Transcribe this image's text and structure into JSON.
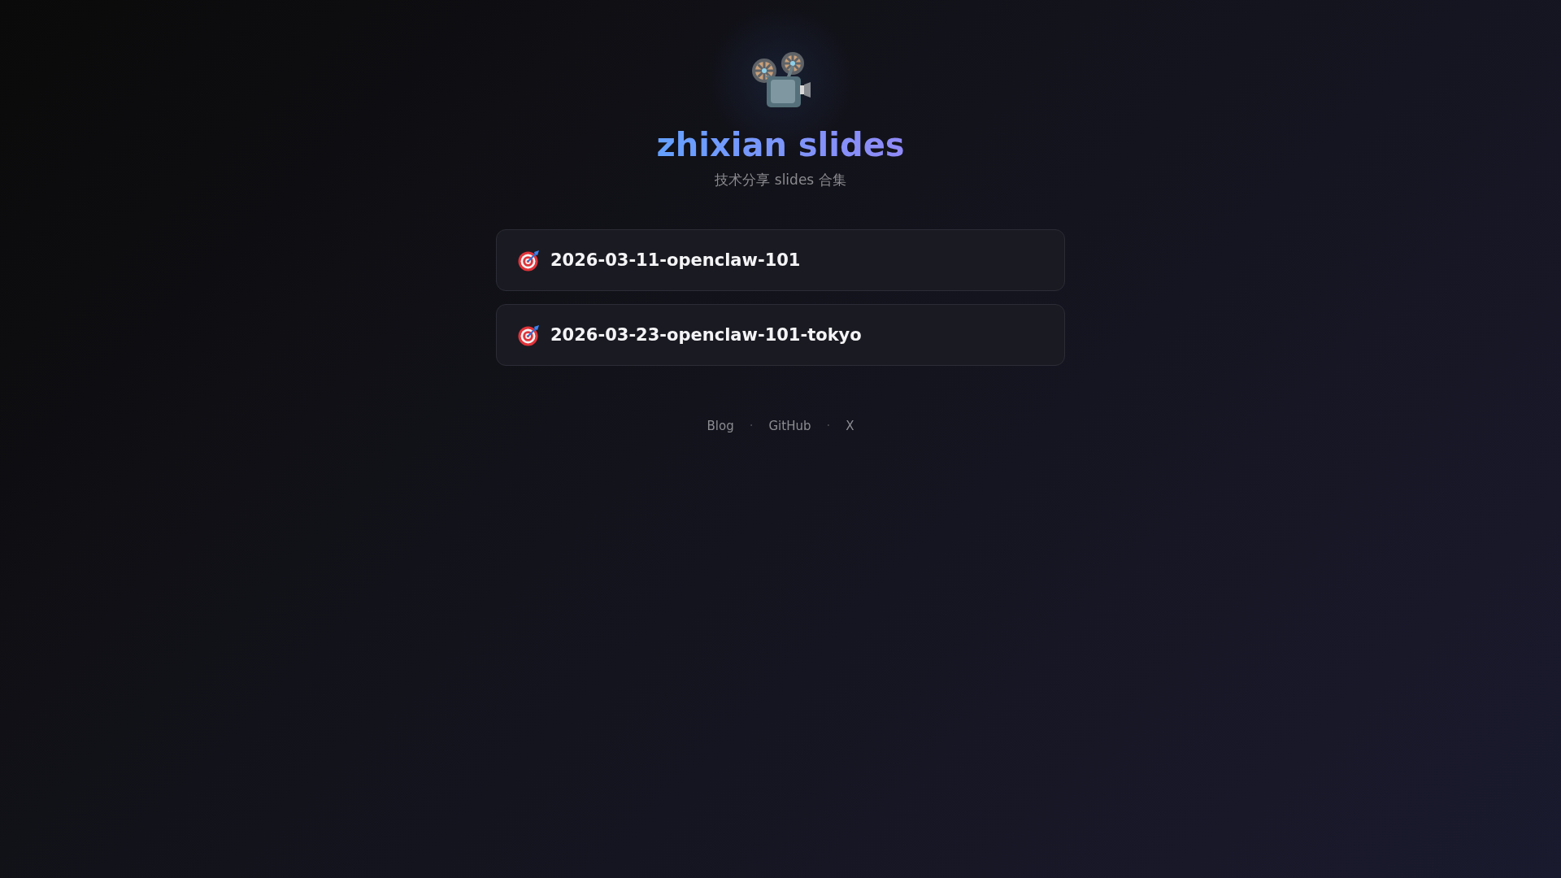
{
  "header": {
    "title": "zhixian slides",
    "subtitle": "技术分享 slides 合集"
  },
  "slides": [
    {
      "title": "2026-03-11-openclaw-101"
    },
    {
      "title": "2026-03-23-openclaw-101-tokyo"
    }
  ],
  "footer": {
    "items": [
      {
        "kind": "link",
        "text": "Blog"
      },
      {
        "kind": "separator",
        "text": "·"
      },
      {
        "kind": "link",
        "text": "GitHub"
      },
      {
        "kind": "separator",
        "text": "·"
      },
      {
        "kind": "link",
        "text": "X"
      }
    ]
  }
}
